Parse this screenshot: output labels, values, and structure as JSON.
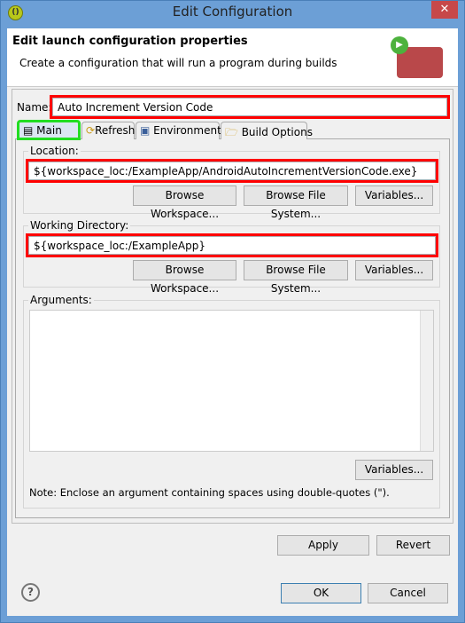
{
  "window": {
    "title": "Edit Configuration",
    "close": "✕"
  },
  "header": {
    "title": "Edit launch configuration properties",
    "subtitle": "Create a configuration that will run a program during builds"
  },
  "name": {
    "label": "Name:",
    "value": "Auto Increment Version Code"
  },
  "tabs": [
    {
      "label": "Main",
      "icon": "document-icon",
      "active": true
    },
    {
      "label": "Refresh",
      "icon": "refresh-icon"
    },
    {
      "label": "Environment",
      "icon": "environment-icon"
    },
    {
      "label": "Build Options",
      "icon": "folder-icon"
    }
  ],
  "location": {
    "label": "Location:",
    "value": "${workspace_loc:/ExampleApp/AndroidAutoIncrementVersionCode.exe}",
    "browse_workspace": "Browse Workspace...",
    "browse_fs": "Browse File System...",
    "variables": "Variables..."
  },
  "working_dir": {
    "label": "Working Directory:",
    "value": "${workspace_loc:/ExampleApp}",
    "browse_workspace": "Browse Workspace...",
    "browse_fs": "Browse File System...",
    "variables": "Variables..."
  },
  "arguments": {
    "label": "Arguments:",
    "value": "",
    "variables": "Variables...",
    "note": "Note: Enclose an argument containing spaces using double-quotes (\")."
  },
  "buttons": {
    "apply": "Apply",
    "revert": "Revert",
    "ok": "OK",
    "cancel": "Cancel",
    "help": "?"
  },
  "colors": {
    "highlight_red": "#ff0000",
    "highlight_green": "#00dd00",
    "titlebar": "#6c9fd6"
  }
}
